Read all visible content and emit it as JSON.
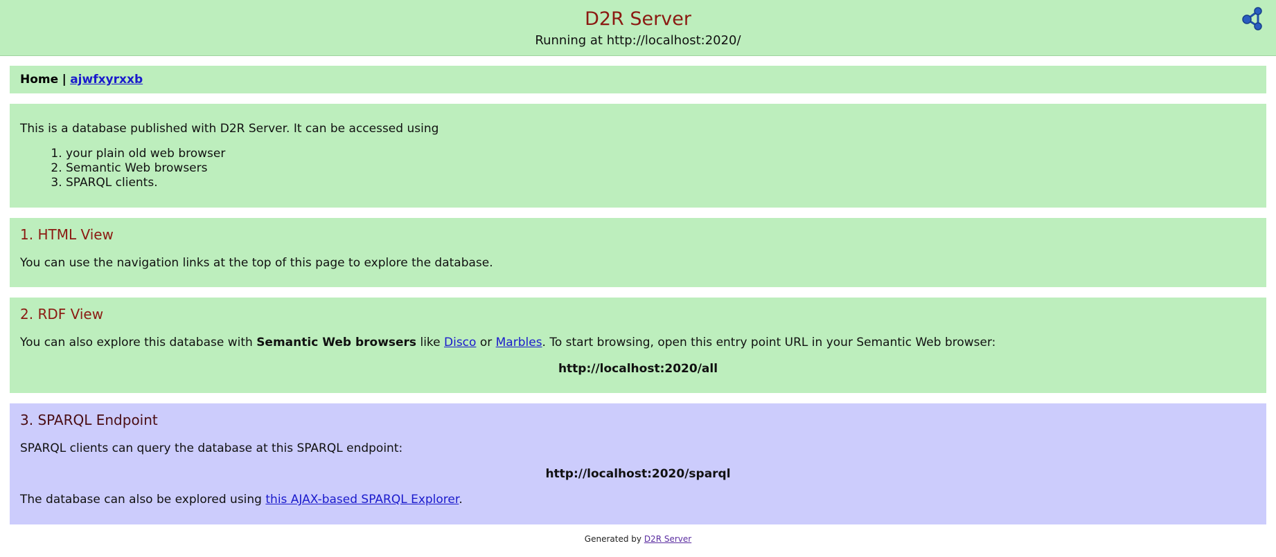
{
  "header": {
    "title": "D2R Server",
    "subtitle": "Running at http://localhost:2020/",
    "logo_icon": "rdf-graph-icon"
  },
  "nav": {
    "home": "Home",
    "separator": "|",
    "link": "ajwfxyrxxb"
  },
  "intro": {
    "text": "This is a database published with D2R Server. It can be accessed using",
    "items": [
      "your plain old web browser",
      "Semantic Web browsers",
      "SPARQL clients."
    ]
  },
  "html_view": {
    "heading": "1. HTML View",
    "text": "You can use the navigation links at the top of this page to explore the database."
  },
  "rdf_view": {
    "heading": "2. RDF View",
    "text_1": "You can also explore this database with ",
    "bold": "Semantic Web browsers",
    "text_2": " like ",
    "link_disco": "Disco",
    "text_3": " or ",
    "link_marbles": "Marbles",
    "text_4": ". To start browsing, open this entry point URL in your Semantic Web browser:",
    "entry_url": "http://localhost:2020/all"
  },
  "sparql": {
    "heading": "3. SPARQL Endpoint",
    "text": "SPARQL clients can query the database at this SPARQL endpoint:",
    "endpoint_url": "http://localhost:2020/sparql",
    "explore_text": "The database can also be explored using ",
    "explore_link": "this AJAX-based SPARQL Explorer",
    "explore_end": "."
  },
  "footer": {
    "text": "Generated by ",
    "link": "D2R Server"
  },
  "colors": {
    "panel_green": "#bdeebd",
    "panel_blue": "#ccccfc",
    "heading_red": "#8b1a12",
    "link_blue": "#1a1acc"
  }
}
